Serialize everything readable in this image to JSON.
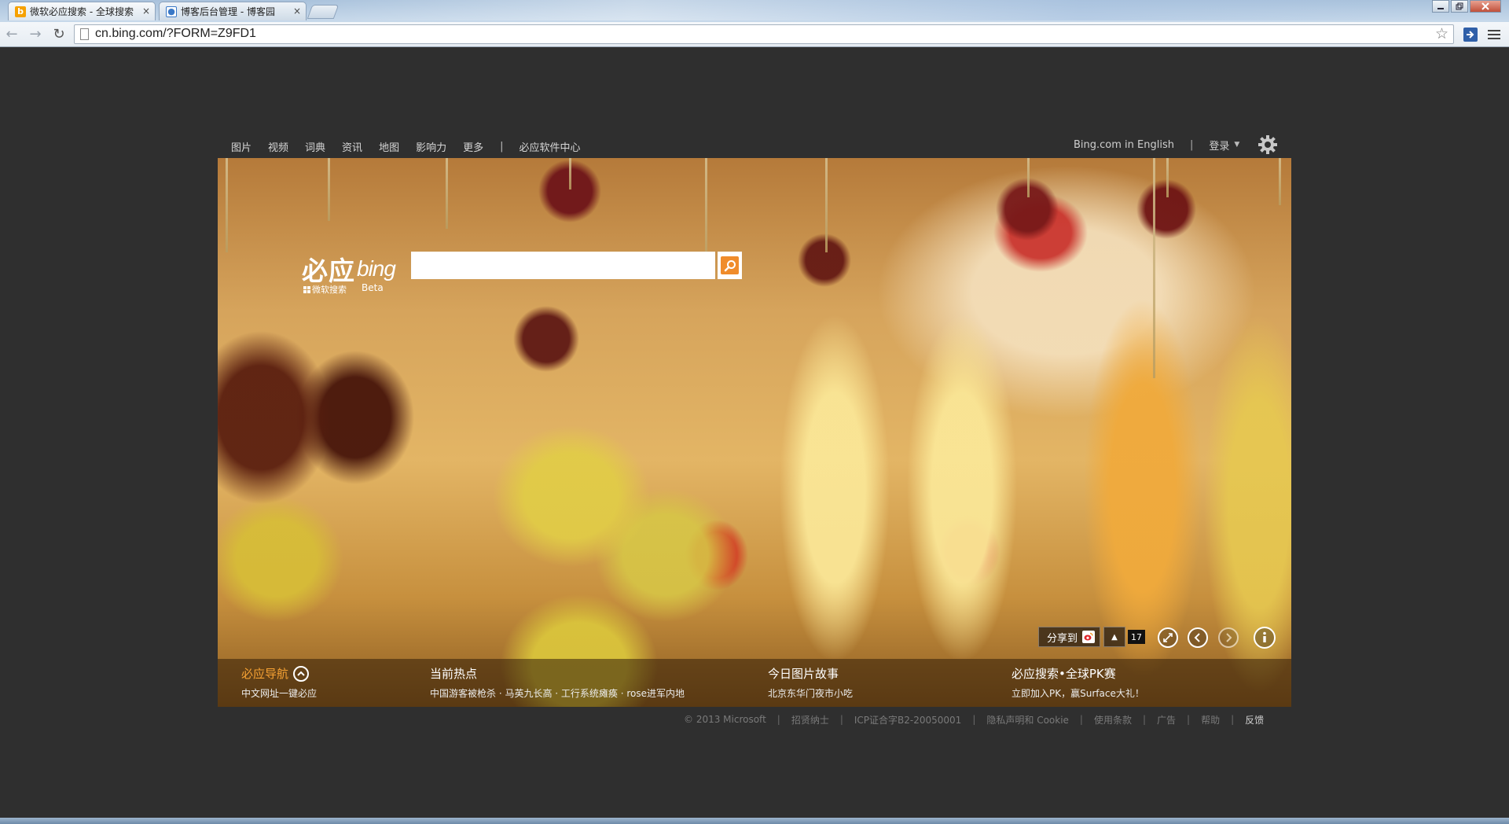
{
  "browser": {
    "tabs": [
      {
        "title": "微软必应搜索 - 全球搜索",
        "icon": "bing-favicon"
      },
      {
        "title": "博客后台管理 - 博客园",
        "icon": "cnblogs-favicon"
      }
    ],
    "tab_close": "×",
    "url": "cn.bing.com/?FORM=Z9FD1",
    "window_buttons": [
      "minimize",
      "restore",
      "close"
    ]
  },
  "nav": {
    "items": [
      "图片",
      "视频",
      "词典",
      "资讯",
      "地图",
      "影响力",
      "更多"
    ],
    "separator": "|",
    "software_center": "必应软件中心"
  },
  "account": {
    "english": "Bing.com in English",
    "separator": "|",
    "login": "登录",
    "caret": "▼"
  },
  "logo": {
    "zh": "必应",
    "en": "bing",
    "company": "微软搜索",
    "beta": "Beta"
  },
  "search": {
    "value": "",
    "placeholder": ""
  },
  "hero_controls": {
    "share_label": "分享到",
    "share_count": "17"
  },
  "strip": [
    {
      "title": "必应导航",
      "subtitle": "中文网址一键必应",
      "accent": true
    },
    {
      "title": "当前热点",
      "subtitle": "中国游客被枪杀 · 马英九长高 · 工行系统瘫痪 · rose进军内地",
      "accent": false
    },
    {
      "title": "今日图片故事",
      "subtitle": "北京东华门夜市小吃",
      "accent": false
    },
    {
      "title": "必应搜索•全球PK赛",
      "subtitle": "立即加入PK，赢Surface大礼！",
      "accent": false
    }
  ],
  "footer": {
    "items": [
      "© 2013 Microsoft",
      "招贤纳士",
      "ICP证合字B2-20050001",
      "隐私声明和 Cookie",
      "使用条款",
      "广告",
      "帮助"
    ],
    "last": "反馈",
    "separator": "|"
  },
  "colors": {
    "page_bg": "#2f2f2f",
    "accent_orange": "#f7a233",
    "search_orange": "#f08c2b"
  }
}
